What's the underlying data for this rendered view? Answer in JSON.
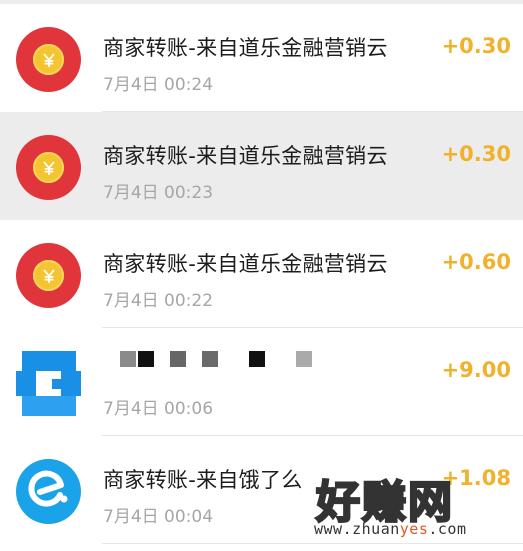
{
  "transactions": [
    {
      "title": "商家转账-来自道乐金融营销云",
      "time": "7月4日 00:24",
      "amount": "+0.30",
      "icon": "red-envelope-icon"
    },
    {
      "title": "商家转账-来自道乐金融营销云",
      "time": "7月4日 00:23",
      "amount": "+0.30",
      "icon": "red-envelope-icon"
    },
    {
      "title": "商家转账-来自道乐金融营销云",
      "time": "7月4日 00:22",
      "amount": "+0.60",
      "icon": "red-envelope-icon"
    },
    {
      "title": "",
      "time": "7月4日 00:06",
      "amount": "+9.00",
      "icon": "pixelated-avatar-icon"
    },
    {
      "title": "商家转账-来自饿了么",
      "time": "7月4日 00:04",
      "amount": "+1.08",
      "icon": "eleme-icon"
    }
  ],
  "watermark": {
    "brand": "好赚网",
    "url_pre": "www.zhuan",
    "url_hl": "yes",
    "url_post": ".com"
  },
  "colors": {
    "amount": "#f1b12b",
    "red_envelope": "#e0363b",
    "coin": "#f4c531",
    "eleme_blue": "#1aa3e8",
    "highlight_row": "#ececec"
  }
}
